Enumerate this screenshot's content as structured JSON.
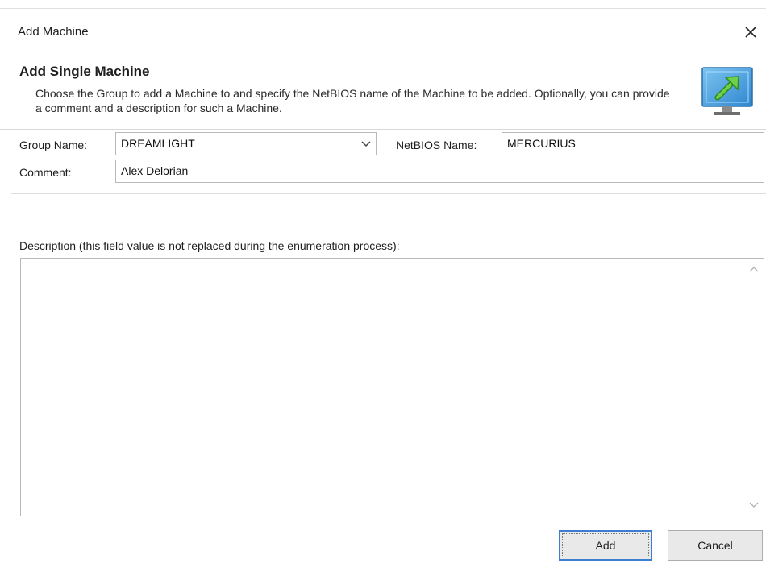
{
  "window": {
    "title": "Add Machine",
    "close_icon": "close-icon"
  },
  "header": {
    "title": "Add Single Machine",
    "description": "Choose the Group to add a Machine to and specify the NetBIOS name of the Machine to be added. Optionally, you can provide a comment and a description for such a Machine.",
    "icon": "monitor-arrow-icon"
  },
  "form": {
    "group_label": "Group Name:",
    "group_value": "DREAMLIGHT",
    "netbios_label": "NetBIOS Name:",
    "netbios_value": "MERCURIUS",
    "comment_label": "Comment:",
    "comment_value": "Alex Delorian",
    "description_label": "Description (this field value is not replaced during the enumeration process):",
    "description_value": ""
  },
  "buttons": {
    "add": "Add",
    "cancel": "Cancel"
  },
  "colors": {
    "accent": "#3c7fd1",
    "icon_arrow": "#3fae2a",
    "icon_screen": "#4aa0dd"
  }
}
